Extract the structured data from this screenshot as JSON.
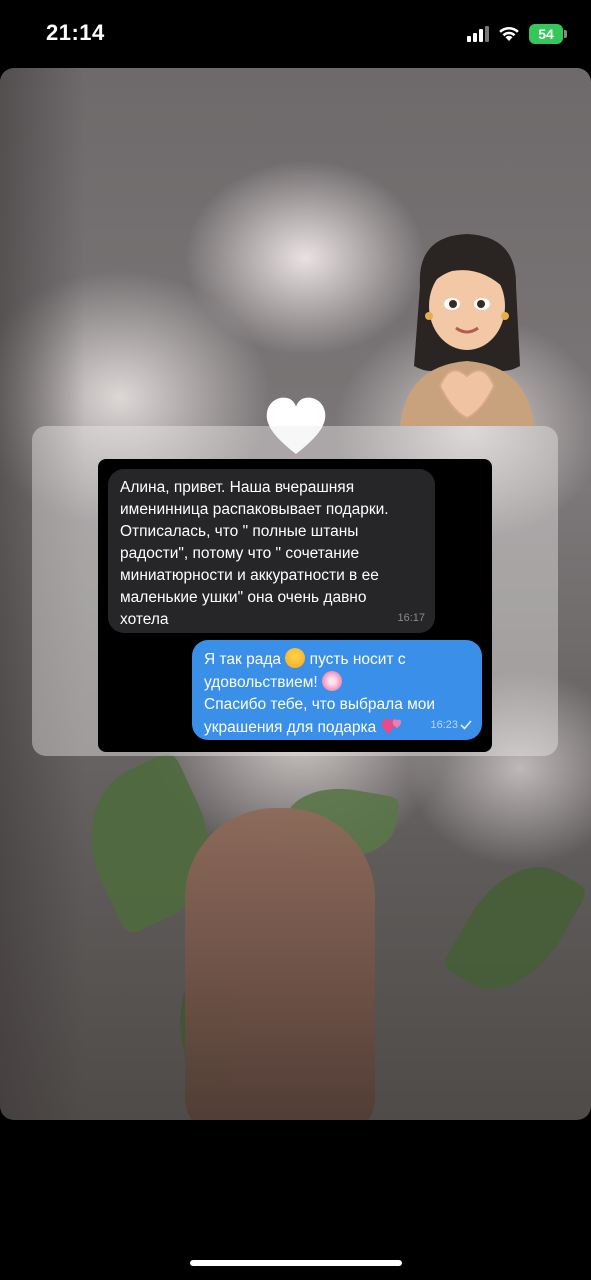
{
  "status_bar": {
    "time": "21:14",
    "battery": "54",
    "icons": [
      "cellular-signal-icon",
      "wifi-icon",
      "battery-charging-icon"
    ]
  },
  "story": {
    "background": "peony bouquet photo",
    "decorations": [
      "memoji-heart-hands",
      "white-heart"
    ],
    "chat": {
      "incoming": {
        "text": "Алина, привет. Наша вчерашняя\nименинница распаковывает подарки.\nОтписалась, что \" полные штаны\nрадости\", потому что \" сочетание\nминиатюрности и аккуратности в ее\nмаленькие ушки\" она очень давно\nхотела",
        "time": "16:17"
      },
      "outgoing": {
        "line1": "Я так рада",
        "line1_tail": "пусть носит с",
        "line2": "удовольствием!",
        "line3": "Спасибо тебе, что выбрала мои",
        "line4": "украшения для подарка",
        "time": "16:23",
        "emojis": [
          "smiling-face-emoji",
          "cherry-blossom-emoji",
          "two-hearts-emoji"
        ]
      }
    }
  },
  "colors": {
    "incoming_bubble": "#262628",
    "outgoing_bubble": "#3a8fe9",
    "battery": "#35c759"
  }
}
